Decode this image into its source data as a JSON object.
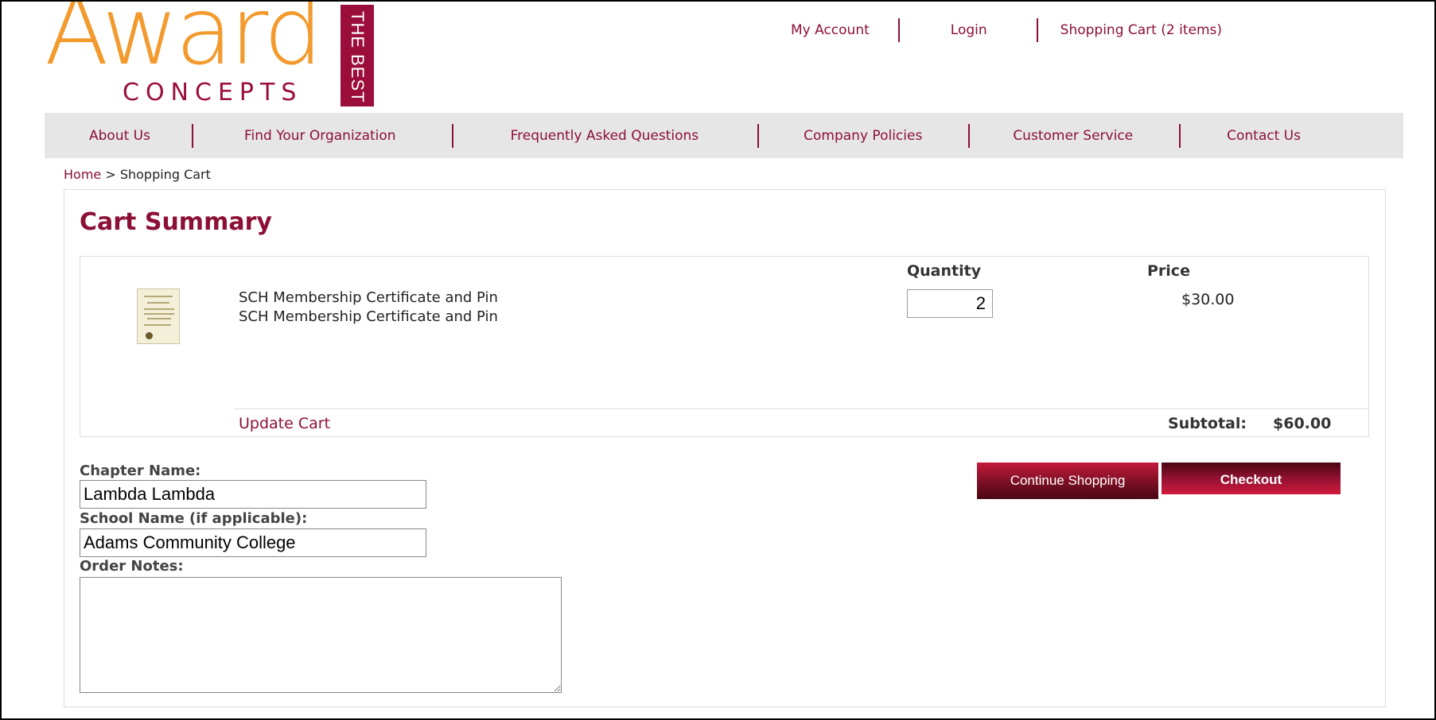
{
  "brand": {
    "logo_word": "Award",
    "logo_sub": "CONCEPTS",
    "logo_tag": "THE BEST"
  },
  "top_links": [
    "My Account",
    "Login",
    "Shopping Cart (2 items)"
  ],
  "nav": [
    "About Us",
    "Find Your Organization",
    "Frequently Asked Questions",
    "Company Policies",
    "Customer Service",
    "Contact Us"
  ],
  "breadcrumb": {
    "home": "Home",
    "sep": ">",
    "current": "Shopping Cart"
  },
  "cart": {
    "title": "Cart Summary",
    "columns": {
      "quantity": "Quantity",
      "price": "Price"
    },
    "item": {
      "name_line1": "SCH Membership Certificate and Pin",
      "name_line2": "SCH Membership Certificate and Pin",
      "quantity": "2",
      "price": "$30.00"
    },
    "update_label": "Update Cart",
    "subtotal_label": "Subtotal:",
    "subtotal_value": "$60.00"
  },
  "form": {
    "chapter_label": "Chapter Name:",
    "chapter_value": "Lambda Lambda",
    "school_label": "School Name (if applicable):",
    "school_value": "Adams Community College",
    "notes_label": "Order Notes:",
    "notes_value": ""
  },
  "buttons": {
    "continue": "Continue Shopping",
    "checkout": "Checkout"
  },
  "colors": {
    "brand": "#8c1036",
    "logo_orange": "#f39a2e",
    "nav_bg": "#e6e6e6"
  }
}
